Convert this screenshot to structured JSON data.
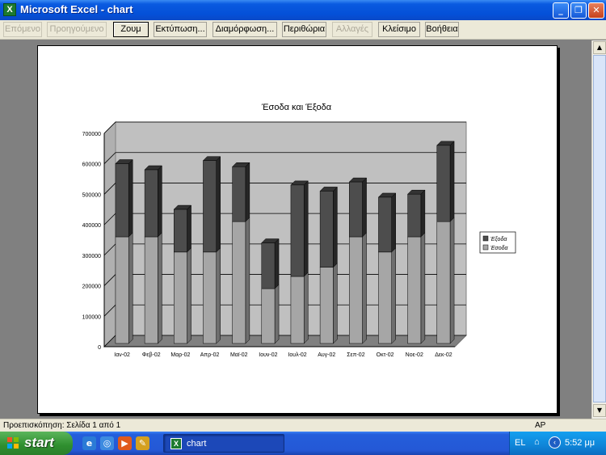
{
  "window": {
    "title": "Microsoft Excel - chart",
    "app_icon": "X",
    "controls": {
      "minimize": "_",
      "restore": "❐",
      "close": "✕"
    }
  },
  "toolbar": {
    "buttons": [
      {
        "label": "Επόμενο",
        "enabled": false
      },
      {
        "label": "Προηγούμενο",
        "enabled": false
      },
      {
        "label": "Ζουμ",
        "enabled": true
      },
      {
        "label": "Εκτύπωση...",
        "enabled": true
      },
      {
        "label": "Διαμόρφωση...",
        "enabled": true
      },
      {
        "label": "Περιθώρια",
        "enabled": true
      },
      {
        "label": "Αλλαγές",
        "enabled": false
      },
      {
        "label": "Κλείσιμο",
        "enabled": true
      },
      {
        "label": "Βοήθεια",
        "enabled": true
      }
    ]
  },
  "statusbar": {
    "text": "Προεπισκόπηση: Σελίδα 1 από 1",
    "num": "ΑΡ"
  },
  "taskbar": {
    "start_label": "start",
    "task_label": "chart",
    "lang": "EL",
    "clock": "5:52 μμ"
  },
  "chart_data": {
    "type": "bar",
    "stacked": true,
    "three_d": true,
    "title": "Έσοδα και Έξοδα",
    "categories": [
      "Ιαν-02",
      "Φεβ-02",
      "Μαρ-02",
      "Απρ-02",
      "Μαϊ-02",
      "Ιουν-02",
      "Ιουλ-02",
      "Αυγ-02",
      "Σεπ-02",
      "Οκτ-02",
      "Νοε-02",
      "Δεκ-02"
    ],
    "series": [
      {
        "name": "Έσοδα",
        "color": "#a6a6a6",
        "values": [
          350000,
          350000,
          300000,
          300000,
          400000,
          180000,
          220000,
          250000,
          350000,
          300000,
          350000,
          400000
        ]
      },
      {
        "name": "Έξοδα",
        "color": "#4d4d4d",
        "values": [
          240000,
          220000,
          140000,
          300000,
          180000,
          150000,
          300000,
          250000,
          180000,
          180000,
          140000,
          250000
        ]
      }
    ],
    "yticks": [
      "0",
      "100000",
      "200000",
      "300000",
      "400000",
      "500000",
      "600000",
      "700000"
    ],
    "ylim": [
      0,
      700000
    ],
    "grid": true,
    "legend_position": "right"
  }
}
